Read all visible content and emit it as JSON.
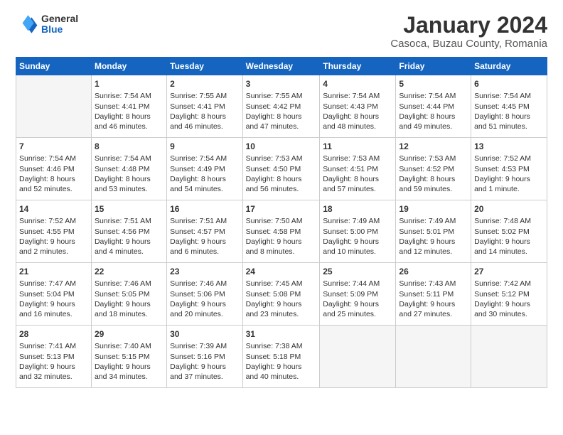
{
  "logo": {
    "general": "General",
    "blue": "Blue"
  },
  "header": {
    "month": "January 2024",
    "location": "Casoca, Buzau County, Romania"
  },
  "weekdays": [
    "Sunday",
    "Monday",
    "Tuesday",
    "Wednesday",
    "Thursday",
    "Friday",
    "Saturday"
  ],
  "weeks": [
    [
      {
        "day": "",
        "info": ""
      },
      {
        "day": "1",
        "info": "Sunrise: 7:54 AM\nSunset: 4:41 PM\nDaylight: 8 hours\nand 46 minutes."
      },
      {
        "day": "2",
        "info": "Sunrise: 7:55 AM\nSunset: 4:41 PM\nDaylight: 8 hours\nand 46 minutes."
      },
      {
        "day": "3",
        "info": "Sunrise: 7:55 AM\nSunset: 4:42 PM\nDaylight: 8 hours\nand 47 minutes."
      },
      {
        "day": "4",
        "info": "Sunrise: 7:54 AM\nSunset: 4:43 PM\nDaylight: 8 hours\nand 48 minutes."
      },
      {
        "day": "5",
        "info": "Sunrise: 7:54 AM\nSunset: 4:44 PM\nDaylight: 8 hours\nand 49 minutes."
      },
      {
        "day": "6",
        "info": "Sunrise: 7:54 AM\nSunset: 4:45 PM\nDaylight: 8 hours\nand 51 minutes."
      }
    ],
    [
      {
        "day": "7",
        "info": "Sunrise: 7:54 AM\nSunset: 4:46 PM\nDaylight: 8 hours\nand 52 minutes."
      },
      {
        "day": "8",
        "info": "Sunrise: 7:54 AM\nSunset: 4:48 PM\nDaylight: 8 hours\nand 53 minutes."
      },
      {
        "day": "9",
        "info": "Sunrise: 7:54 AM\nSunset: 4:49 PM\nDaylight: 8 hours\nand 54 minutes."
      },
      {
        "day": "10",
        "info": "Sunrise: 7:53 AM\nSunset: 4:50 PM\nDaylight: 8 hours\nand 56 minutes."
      },
      {
        "day": "11",
        "info": "Sunrise: 7:53 AM\nSunset: 4:51 PM\nDaylight: 8 hours\nand 57 minutes."
      },
      {
        "day": "12",
        "info": "Sunrise: 7:53 AM\nSunset: 4:52 PM\nDaylight: 8 hours\nand 59 minutes."
      },
      {
        "day": "13",
        "info": "Sunrise: 7:52 AM\nSunset: 4:53 PM\nDaylight: 9 hours\nand 1 minute."
      }
    ],
    [
      {
        "day": "14",
        "info": "Sunrise: 7:52 AM\nSunset: 4:55 PM\nDaylight: 9 hours\nand 2 minutes."
      },
      {
        "day": "15",
        "info": "Sunrise: 7:51 AM\nSunset: 4:56 PM\nDaylight: 9 hours\nand 4 minutes."
      },
      {
        "day": "16",
        "info": "Sunrise: 7:51 AM\nSunset: 4:57 PM\nDaylight: 9 hours\nand 6 minutes."
      },
      {
        "day": "17",
        "info": "Sunrise: 7:50 AM\nSunset: 4:58 PM\nDaylight: 9 hours\nand 8 minutes."
      },
      {
        "day": "18",
        "info": "Sunrise: 7:49 AM\nSunset: 5:00 PM\nDaylight: 9 hours\nand 10 minutes."
      },
      {
        "day": "19",
        "info": "Sunrise: 7:49 AM\nSunset: 5:01 PM\nDaylight: 9 hours\nand 12 minutes."
      },
      {
        "day": "20",
        "info": "Sunrise: 7:48 AM\nSunset: 5:02 PM\nDaylight: 9 hours\nand 14 minutes."
      }
    ],
    [
      {
        "day": "21",
        "info": "Sunrise: 7:47 AM\nSunset: 5:04 PM\nDaylight: 9 hours\nand 16 minutes."
      },
      {
        "day": "22",
        "info": "Sunrise: 7:46 AM\nSunset: 5:05 PM\nDaylight: 9 hours\nand 18 minutes."
      },
      {
        "day": "23",
        "info": "Sunrise: 7:46 AM\nSunset: 5:06 PM\nDaylight: 9 hours\nand 20 minutes."
      },
      {
        "day": "24",
        "info": "Sunrise: 7:45 AM\nSunset: 5:08 PM\nDaylight: 9 hours\nand 23 minutes."
      },
      {
        "day": "25",
        "info": "Sunrise: 7:44 AM\nSunset: 5:09 PM\nDaylight: 9 hours\nand 25 minutes."
      },
      {
        "day": "26",
        "info": "Sunrise: 7:43 AM\nSunset: 5:11 PM\nDaylight: 9 hours\nand 27 minutes."
      },
      {
        "day": "27",
        "info": "Sunrise: 7:42 AM\nSunset: 5:12 PM\nDaylight: 9 hours\nand 30 minutes."
      }
    ],
    [
      {
        "day": "28",
        "info": "Sunrise: 7:41 AM\nSunset: 5:13 PM\nDaylight: 9 hours\nand 32 minutes."
      },
      {
        "day": "29",
        "info": "Sunrise: 7:40 AM\nSunset: 5:15 PM\nDaylight: 9 hours\nand 34 minutes."
      },
      {
        "day": "30",
        "info": "Sunrise: 7:39 AM\nSunset: 5:16 PM\nDaylight: 9 hours\nand 37 minutes."
      },
      {
        "day": "31",
        "info": "Sunrise: 7:38 AM\nSunset: 5:18 PM\nDaylight: 9 hours\nand 40 minutes."
      },
      {
        "day": "",
        "info": ""
      },
      {
        "day": "",
        "info": ""
      },
      {
        "day": "",
        "info": ""
      }
    ]
  ]
}
